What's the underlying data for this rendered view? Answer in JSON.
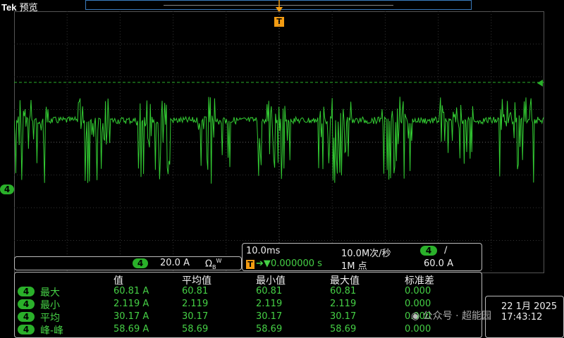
{
  "brand": {
    "logo": "Tek",
    "mode": "预览"
  },
  "trigger_marker": "T",
  "channel": {
    "number": "4",
    "color": "#33cc33"
  },
  "ch_readout": {
    "scale": "20.0 A",
    "bw_symbol": "Ω",
    "bw_sub": "B",
    "bw_sup": "W"
  },
  "timebase": {
    "scale": "10.0ms",
    "sample_rate": "10.0M次/秒",
    "record": "1M 点",
    "trigger_pos": "0.000000 s",
    "trigger_level": "60.0 A",
    "trigger_slope": "∕"
  },
  "measurements": {
    "headers": [
      "值",
      "平均值",
      "最小值",
      "最大值",
      "标准差"
    ],
    "rows": [
      {
        "ch": "4",
        "label": "最大",
        "values": [
          "60.81 A",
          "60.81",
          "60.81",
          "60.81",
          "0.000"
        ]
      },
      {
        "ch": "4",
        "label": "最小",
        "values": [
          "2.119 A",
          "2.119",
          "2.119",
          "2.119",
          "0.000"
        ]
      },
      {
        "ch": "4",
        "label": "平均",
        "values": [
          "30.17 A",
          "30.17",
          "30.17",
          "30.17",
          "0.000"
        ]
      },
      {
        "ch": "4",
        "label": "峰-峰",
        "values": [
          "58.69 A",
          "58.69",
          "58.69",
          "58.69",
          "0.000"
        ]
      }
    ]
  },
  "datetime": {
    "date": "22 1月 2025",
    "time": "17:43:12"
  },
  "watermark": "公众号 · 超能园"
}
